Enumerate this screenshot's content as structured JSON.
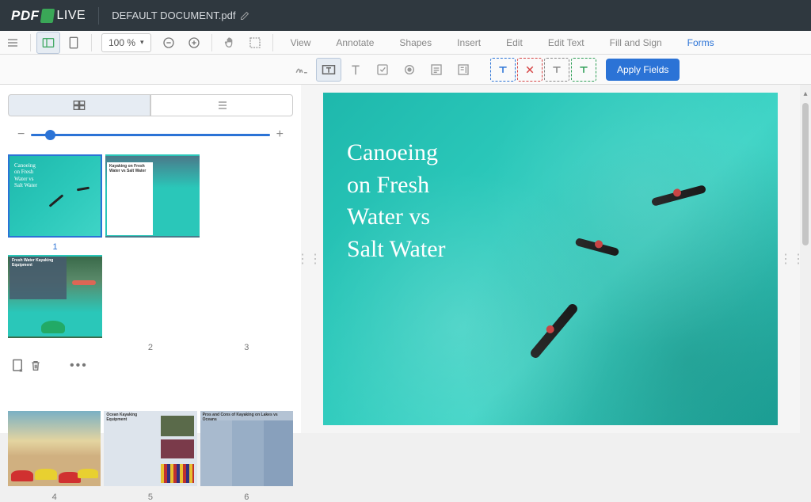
{
  "header": {
    "logo_pdf": "PDF",
    "logo_live": "LIVE",
    "filename": "DEFAULT DOCUMENT.pdf"
  },
  "toolbar": {
    "zoom": "100 %",
    "menu": {
      "view": "View",
      "annotate": "Annotate",
      "shapes": "Shapes",
      "insert": "Insert",
      "edit": "Edit",
      "edit_text": "Edit Text",
      "fill_sign": "Fill and Sign",
      "forms": "Forms"
    }
  },
  "formbar": {
    "apply": "Apply Fields"
  },
  "sidebar": {
    "pages": [
      {
        "num": "1",
        "current": true
      },
      {
        "num": "2",
        "current": false
      },
      {
        "num": "3",
        "current": false
      },
      {
        "num": "4",
        "current": false
      },
      {
        "num": "5",
        "current": false
      },
      {
        "num": "6",
        "current": false
      }
    ],
    "thumb2_heading": "Kayaking on Fresh Water vs Salt Water",
    "thumb3_heading": "Fresh Water Kayaking Equipment",
    "thumb5_heading": "Ocean Kayaking Equipment",
    "thumb6_heading": "Pros and Cons of Kayaking on Lakes vs Oceans"
  },
  "document": {
    "title": "Canoeing\non Fresh\nWater vs\nSalt Water"
  }
}
